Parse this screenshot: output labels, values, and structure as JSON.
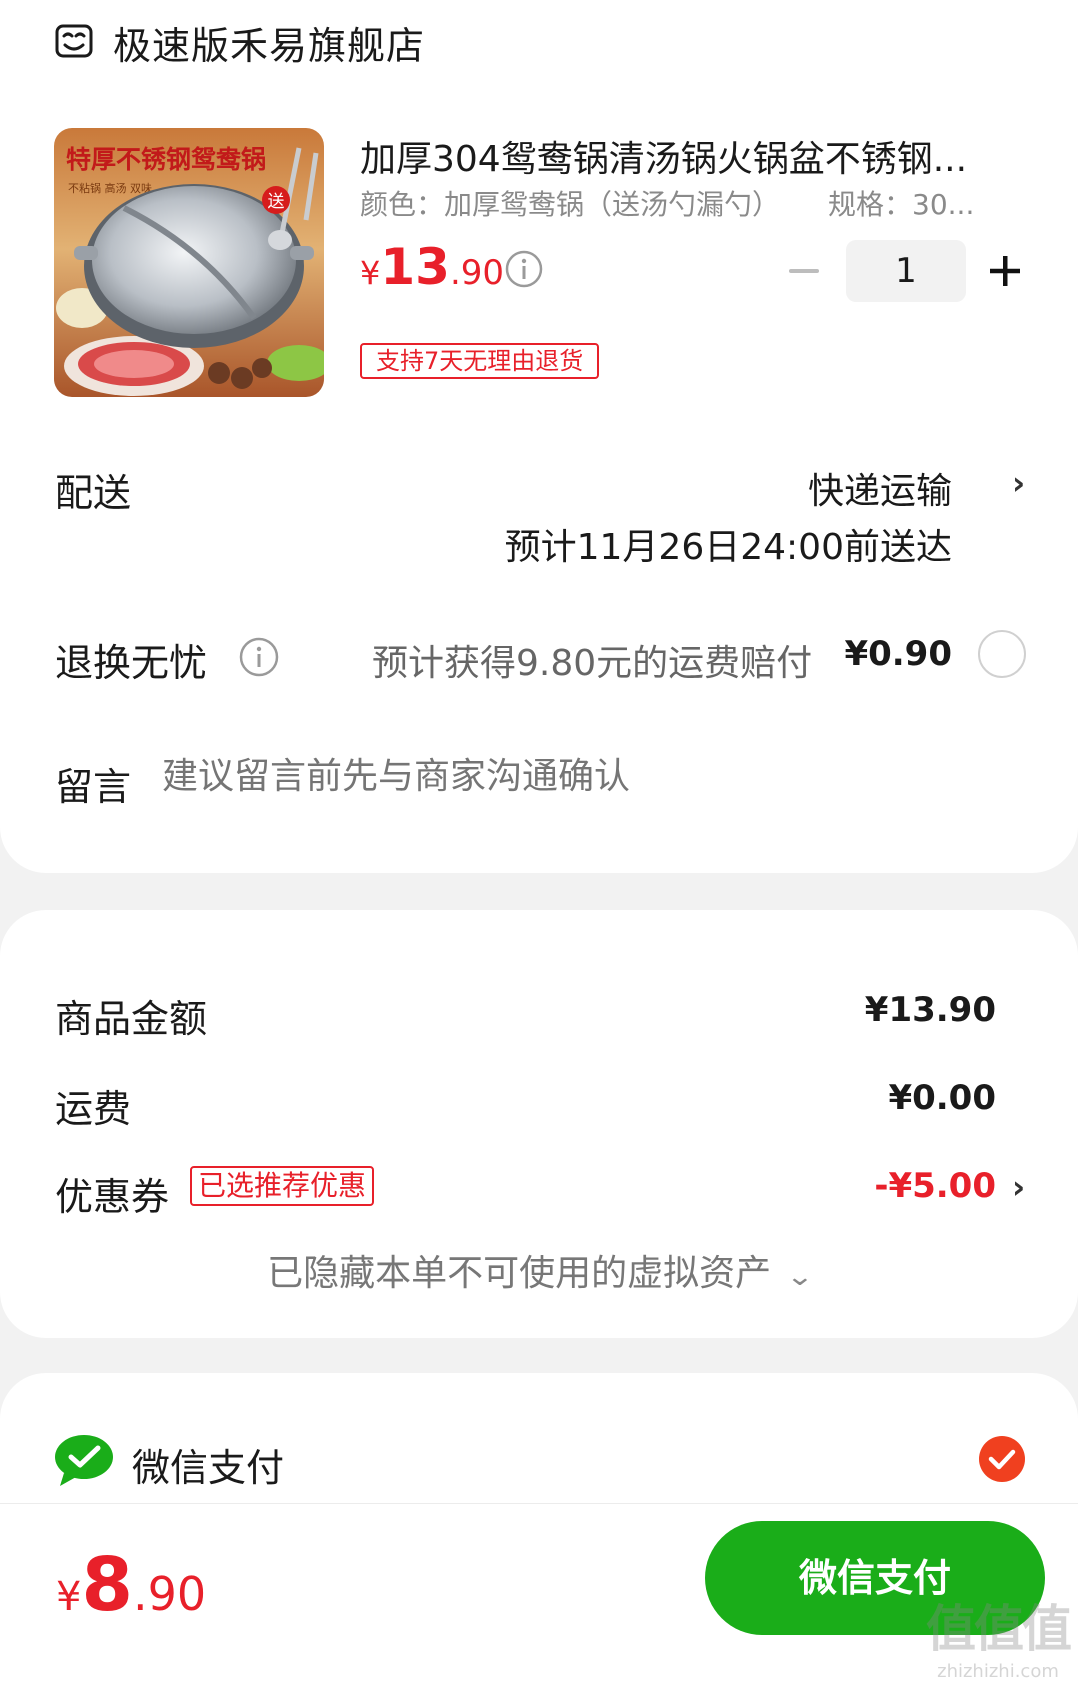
{
  "store": {
    "icon": "store-icon",
    "name": "极速版禾易旗舰店"
  },
  "product": {
    "image": {
      "banner_text": "特厚不锈钢鸳鸯锅",
      "sub_text": "不粘锅 高汤 双味",
      "badge": "送"
    },
    "title": "加厚304鸳鸯锅清汤锅火锅盆不锈钢...",
    "spec_color": "颜色：加厚鸳鸯锅（送汤勺漏勺）",
    "spec_size": "规格：30...",
    "price": {
      "yen": "¥",
      "integer": "13",
      "decimal": ".90"
    },
    "quantity": "1",
    "return_tag": "支持7天无理由退货"
  },
  "shipping": {
    "label": "配送",
    "method": "快递运输",
    "eta": "预计11月26日24:00前送达"
  },
  "return_worry": {
    "label": "退换无忧",
    "description": "预计获得9.80元的运费赔付",
    "price": "¥0.90",
    "selected": false
  },
  "message": {
    "label": "留言",
    "placeholder": "建议留言前先与商家沟通确认"
  },
  "summary": {
    "goods_label": "商品金额",
    "goods_value": "¥13.90",
    "freight_label": "运费",
    "freight_value": "¥0.00",
    "coupon_label": "优惠券",
    "coupon_tag": "已选推荐优惠",
    "coupon_value": "-¥5.00",
    "hidden_assets": "已隐藏本单不可使用的虚拟资产"
  },
  "payment": {
    "method_label": "微信支付",
    "selected": true
  },
  "bottom_bar": {
    "total": {
      "yen": "¥",
      "integer": "8",
      "decimal": ".90"
    },
    "pay_button": "微信支付"
  },
  "watermark": {
    "logo": "值值值",
    "url": "zhizhizhi.com"
  },
  "colors": {
    "accent_red": "#e8202a",
    "wechat_green": "#1aad19"
  }
}
